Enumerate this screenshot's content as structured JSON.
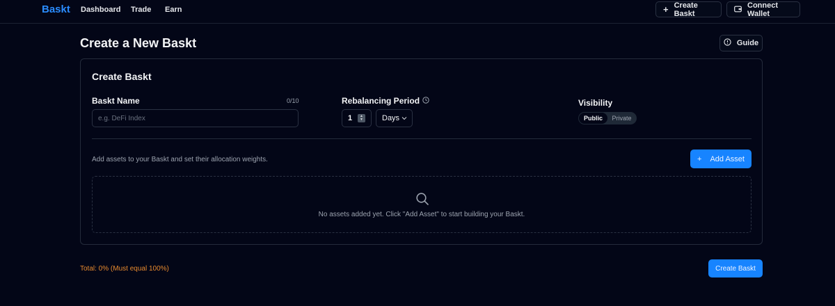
{
  "nav": {
    "brand": "Baskt",
    "links": [
      "Dashboard",
      "Trade",
      "Earn"
    ],
    "create_label": "Create Baskt",
    "connect_label": "Connect Wallet"
  },
  "header": {
    "title": "Create a New Baskt",
    "guide_label": "Guide"
  },
  "card": {
    "title": "Create Baskt",
    "name_label": "Baskt Name",
    "name_counter": "0/10",
    "name_placeholder": "e.g. DeFi Index",
    "name_value": "",
    "rebalance_label": "Rebalancing Period",
    "rebalance_value": "1",
    "rebalance_unit": "Days",
    "visibility_label": "Visibility",
    "visibility_options": [
      "Public",
      "Private"
    ],
    "visibility_selected": "Public",
    "assets_hint": "Add assets to your Baskt and set their allocation weights.",
    "add_asset_label": "Add Asset",
    "empty_text": "No assets added yet. Click \"Add Asset\" to start building your Baskt."
  },
  "footer": {
    "total": "Total: 0%",
    "total_note": "(Must equal 100%)",
    "create_label": "Create Baskt"
  },
  "colors": {
    "background": "#030617",
    "accent": "#1784ff",
    "brand": "#2a8cff",
    "warning": "#e88a2e"
  },
  "icons": {
    "create": "plus-icon",
    "connect": "wallet-icon",
    "guide": "info-circle-icon",
    "rebalance": "clock-icon",
    "days": "chevron-down-icon",
    "add_asset": "plus-icon",
    "empty": "search-icon"
  }
}
